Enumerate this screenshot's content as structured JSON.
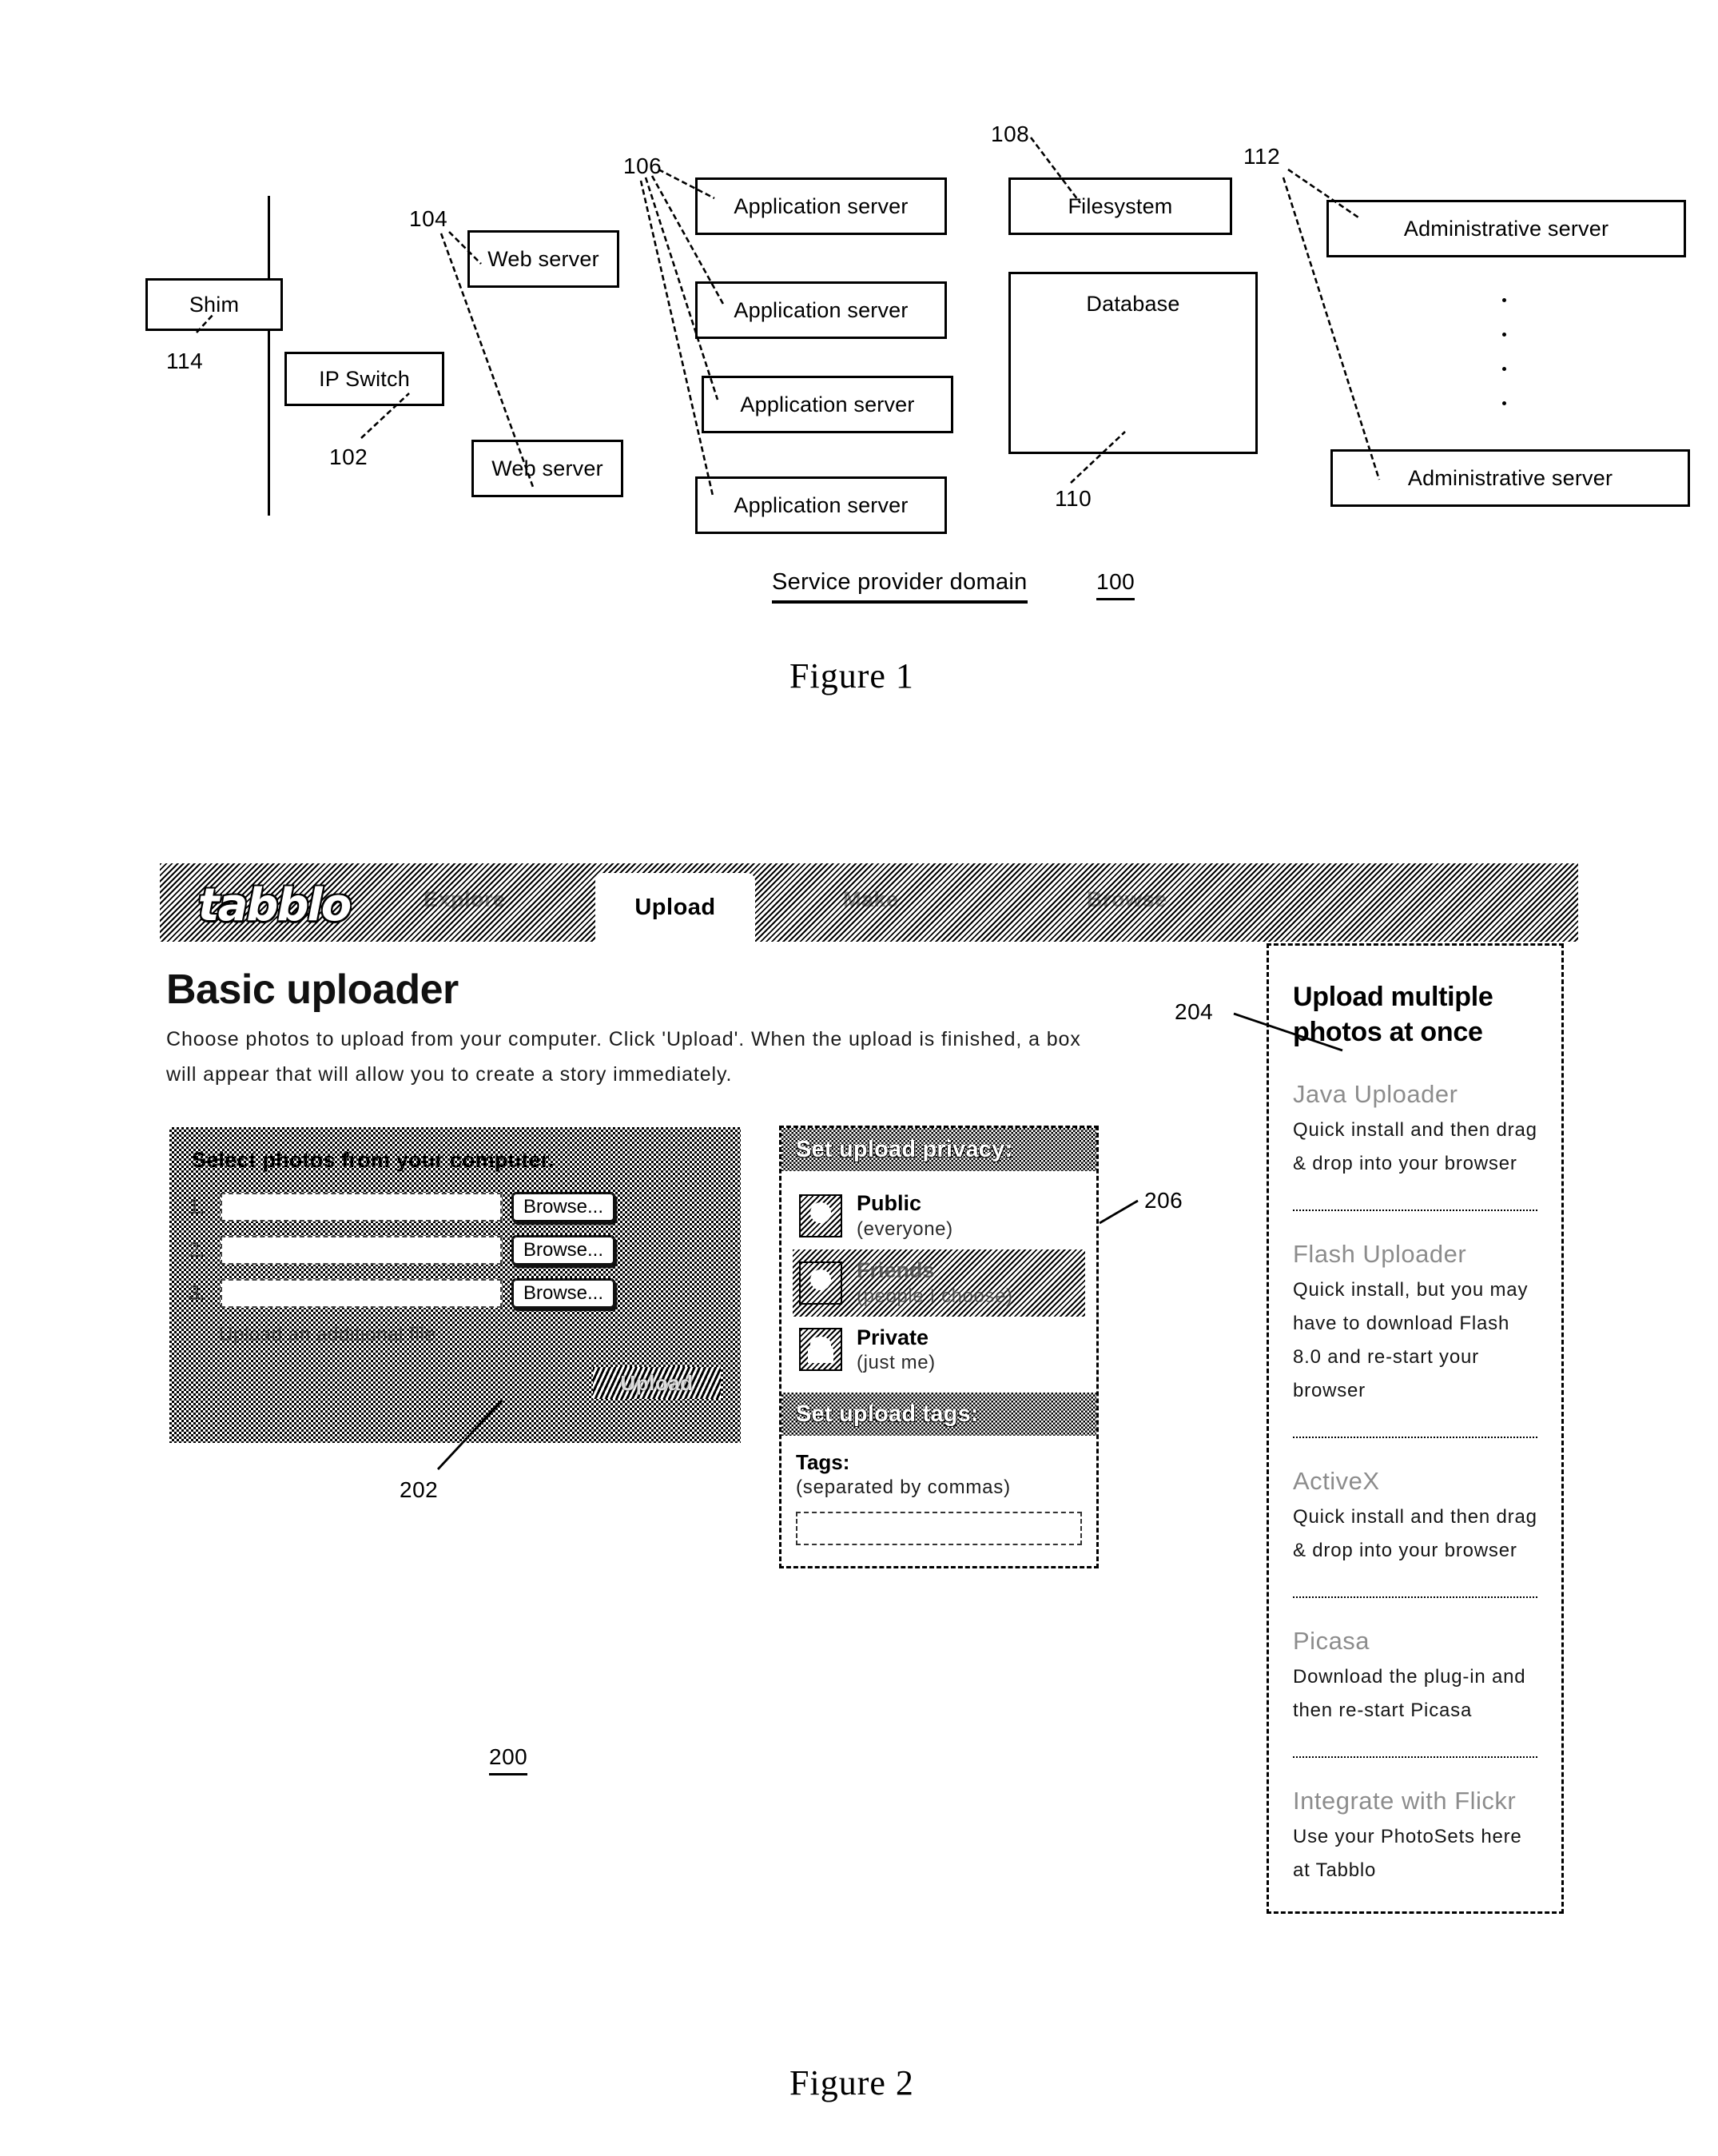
{
  "figure1": {
    "caption": "Figure 1",
    "domain_label": "Service provider domain",
    "domain_ref": "100",
    "boxes": {
      "shim": "Shim",
      "ip_switch": "IP Switch",
      "web_server_1": "Web server",
      "web_server_2": "Web server",
      "app_server_1": "Application server",
      "app_server_2": "Application server",
      "app_server_3": "Application server",
      "app_server_4": "Application server",
      "filesystem": "Filesystem",
      "database": "Database",
      "admin_server_1": "Administrative server",
      "admin_server_2": "Administrative server"
    },
    "refs": {
      "shim": "114",
      "ip_switch": "102",
      "web_server": "104",
      "app_server": "106",
      "filesystem": "108",
      "database": "110",
      "admin_server": "112"
    }
  },
  "figure2": {
    "caption": "Figure 2",
    "page_ref": "200",
    "refs": {
      "select_panel": "202",
      "multi_upload_panel": "204",
      "privacy_panel": "206"
    },
    "header": {
      "logo": "tabblo",
      "tabs": [
        {
          "label": "Explore",
          "active": false
        },
        {
          "label": "Upload",
          "active": true
        },
        {
          "label": "Make",
          "active": false
        },
        {
          "label": "Browse",
          "active": false
        }
      ]
    },
    "page_title": "Basic uploader",
    "page_description": "Choose photos to upload from your computer. Click 'Upload'. When the upload is finished, a box will appear that will allow you to create a story immediately.",
    "select_panel": {
      "title": "Select photos from your computer.",
      "rows": [
        {
          "num": "1.",
          "value": "",
          "browse_label": "Browse..."
        },
        {
          "num": "2.",
          "value": "",
          "browse_label": "Browse..."
        },
        {
          "num": "3.",
          "value": "",
          "browse_label": "Browse..."
        }
      ],
      "additional_link": "Upload an additional file",
      "upload_button": "Upload"
    },
    "privacy_panel": {
      "header": "Set upload privacy:",
      "options": [
        {
          "label": "Public",
          "sub": "(everyone)",
          "selected": false,
          "icon": "globe-icon"
        },
        {
          "label": "Friends",
          "sub": "(people I choose)",
          "selected": true,
          "icon": "people-icon"
        },
        {
          "label": "Private",
          "sub": "(just me)",
          "selected": false,
          "icon": "lock-icon"
        }
      ]
    },
    "tags_panel": {
      "header": "Set upload tags:",
      "label": "Tags:",
      "hint": "(separated by commas)",
      "value": "",
      "placeholder": ""
    },
    "multi_upload_panel": {
      "title": "Upload multiple photos at once",
      "items": [
        {
          "title": "Java Uploader",
          "desc": "Quick install and then drag & drop into your browser"
        },
        {
          "title": "Flash Uploader",
          "desc": "Quick install, but you may have to download Flash 8.0 and re-start your browser"
        },
        {
          "title": "ActiveX",
          "desc": "Quick install and then drag & drop into your browser"
        },
        {
          "title": "Picasa",
          "desc": "Download the plug-in and then re-start Picasa"
        },
        {
          "title": "Integrate with Flickr",
          "desc": "Use your PhotoSets here at Tabblo"
        }
      ]
    }
  }
}
